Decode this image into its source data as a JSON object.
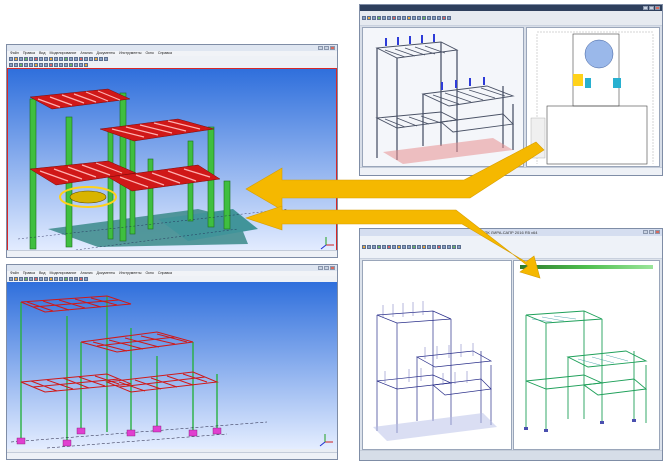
{
  "windows": {
    "top_left": {
      "title": "",
      "menu": [
        "Файл",
        "Правка",
        "Вид",
        "Моделирование",
        "Анализ",
        "Документы",
        "Инструменты",
        "Окно",
        "Справка"
      ],
      "tab_label": "",
      "status": ""
    },
    "bottom_left": {
      "title": "",
      "menu": [
        "Файл",
        "Правка",
        "Вид",
        "Моделирование",
        "Анализ",
        "Документы",
        "Инструменты",
        "Окно",
        "Справка"
      ],
      "tab_label": "",
      "status": ""
    },
    "top_right": {
      "title": "",
      "left_panel_label": "",
      "right_panel_label": "",
      "status": ""
    },
    "bottom_right": {
      "title": "ПК ЛИРА-САПР 2016 R5 x64",
      "left_panel_label": "",
      "right_panel_label": "",
      "status": ""
    }
  },
  "colors": {
    "viewport_blue_top": "#3d7be0",
    "viewport_blue_bottom": "#dfeaff",
    "column_green": "#3fbf3f",
    "beam_red": "#d01818",
    "arrow_yellow": "#f5b800",
    "wire_blue": "#2a2f8a",
    "wire_green": "#1fa05a"
  },
  "icons": [
    "window-minimize-icon",
    "window-maximize-icon",
    "window-close-icon",
    "toolbar-tool-icon",
    "arrow-right-to-left-icon"
  ]
}
